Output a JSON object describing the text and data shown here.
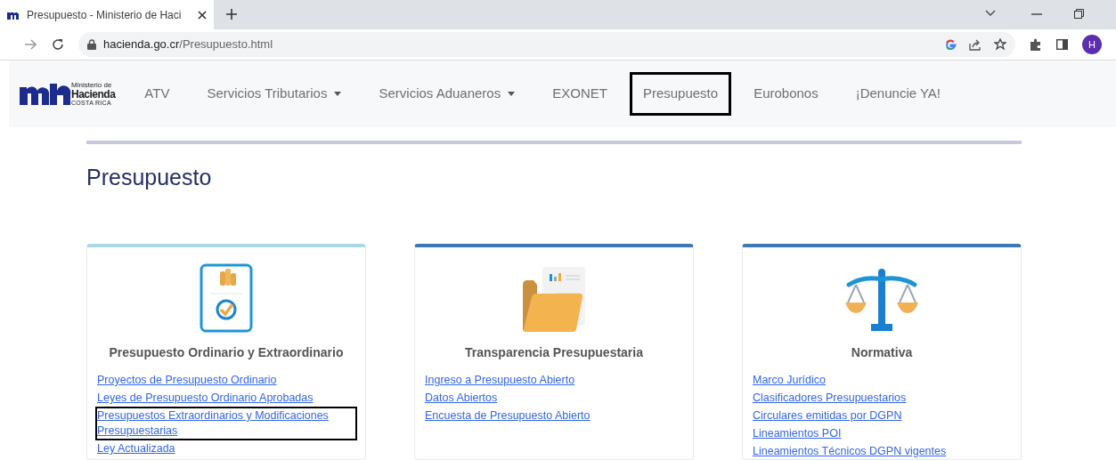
{
  "browser": {
    "tab": {
      "title": "Presupuesto - Ministerio de Haci"
    },
    "url": {
      "host": "hacienda.go.cr",
      "path": "/Presupuesto.html"
    },
    "avatar": "H"
  },
  "navbar": {
    "logo": {
      "line1": "Ministerio de",
      "line2": "Hacienda",
      "line3": "COSTA RICA"
    },
    "items": [
      {
        "label": "ATV",
        "dropdown": false,
        "highlighted": false
      },
      {
        "label": "Servicios Tributarios",
        "dropdown": true,
        "highlighted": false
      },
      {
        "label": "Servicios Aduaneros",
        "dropdown": true,
        "highlighted": false
      },
      {
        "label": "EXONET",
        "dropdown": false,
        "highlighted": false
      },
      {
        "label": "Presupuesto",
        "dropdown": false,
        "highlighted": true
      },
      {
        "label": "Eurobonos",
        "dropdown": false,
        "highlighted": false
      },
      {
        "label": "¡Denuncie YA!",
        "dropdown": false,
        "highlighted": false
      }
    ]
  },
  "page_title": "Presupuesto",
  "cards": [
    {
      "title": "Presupuesto Ordinario y Extraordinario",
      "kind": "document",
      "color": "#a9d9e6",
      "links": [
        {
          "text": "Proyectos de Presupuesto Ordinario",
          "highlighted": false
        },
        {
          "text": "Leyes de Presupuesto Ordinario Aprobadas",
          "highlighted": false
        },
        {
          "text": "Presupuestos Extraordinarios y Modificaciones Presupuestarias",
          "highlighted": true
        },
        {
          "text": "Ley Actualizada",
          "highlighted": false
        }
      ]
    },
    {
      "title": "Transparencia Presupuestaria",
      "kind": "folder",
      "color": "#3d7ab5",
      "links": [
        {
          "text": "Ingreso a Presupuesto Abierto",
          "highlighted": false
        },
        {
          "text": "Datos Abiertos",
          "highlighted": false
        },
        {
          "text": "Encuesta de Presupuesto Abierto",
          "highlighted": false
        }
      ]
    },
    {
      "title": "Normativa",
      "kind": "scales",
      "color": "#3d7ab5",
      "links": [
        {
          "text": "Marco Jurídico",
          "highlighted": false
        },
        {
          "text": "Clasificadores Presupuestarios",
          "highlighted": false
        },
        {
          "text": "Circulares emitidas por DGPN",
          "highlighted": false
        },
        {
          "text": "Lineamientos POI",
          "highlighted": false
        },
        {
          "text": "Lineamientos Técnicos DGPN vigentes",
          "highlighted": false
        }
      ]
    }
  ]
}
